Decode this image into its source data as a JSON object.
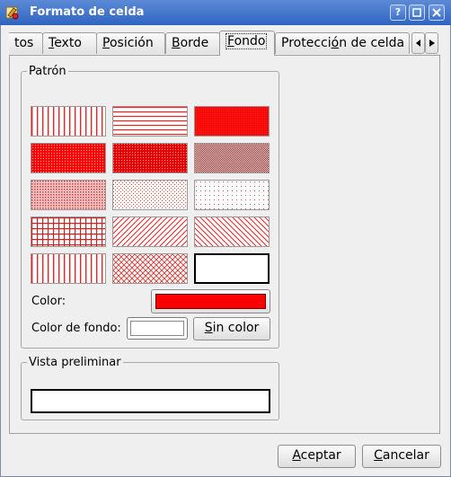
{
  "window": {
    "title": "Formato de celda",
    "help_label": "?"
  },
  "tabs": [
    {
      "label": "tos",
      "mnemonic_pre": "tos",
      "mnemonic_char": "",
      "mnemonic_post": ""
    },
    {
      "label": "Texto",
      "mnemonic_pre": "",
      "mnemonic_char": "T",
      "mnemonic_post": "exto"
    },
    {
      "label": "Posición",
      "mnemonic_pre": "",
      "mnemonic_char": "P",
      "mnemonic_post": "osición"
    },
    {
      "label": "Borde",
      "mnemonic_pre": "",
      "mnemonic_char": "B",
      "mnemonic_post": "orde"
    },
    {
      "label": "Fondo",
      "mnemonic_pre": "",
      "mnemonic_char": "F",
      "mnemonic_post": "ondo"
    },
    {
      "label": "Protección de celda",
      "mnemonic_pre": "Protecci",
      "mnemonic_char": "ó",
      "mnemonic_post": "n de celda"
    }
  ],
  "active_tab": "Fondo",
  "pattern_group": {
    "legend": "Patrón",
    "patterns": [
      "vertical-lines",
      "horizontal-lines",
      "solid-dense",
      "dense-1",
      "dense-2",
      "dense-3",
      "dense-4",
      "dense-5",
      "sparse-dots",
      "grid",
      "diagonal-up",
      "diagonal-down",
      "vertical-lines-2",
      "diagonal-cross",
      "none"
    ],
    "selected": "none",
    "color_label": "Color:",
    "pattern_color": "#ff0000",
    "bg_label": "Color de fondo:",
    "bg_color": "#ffffff",
    "no_color_char": "S",
    "no_color_rest": "in color"
  },
  "preview_group": {
    "legend": "Vista preliminar"
  },
  "footer": {
    "accept_char": "A",
    "accept_rest": "ceptar",
    "cancel_char": "C",
    "cancel_rest": "ancelar"
  }
}
